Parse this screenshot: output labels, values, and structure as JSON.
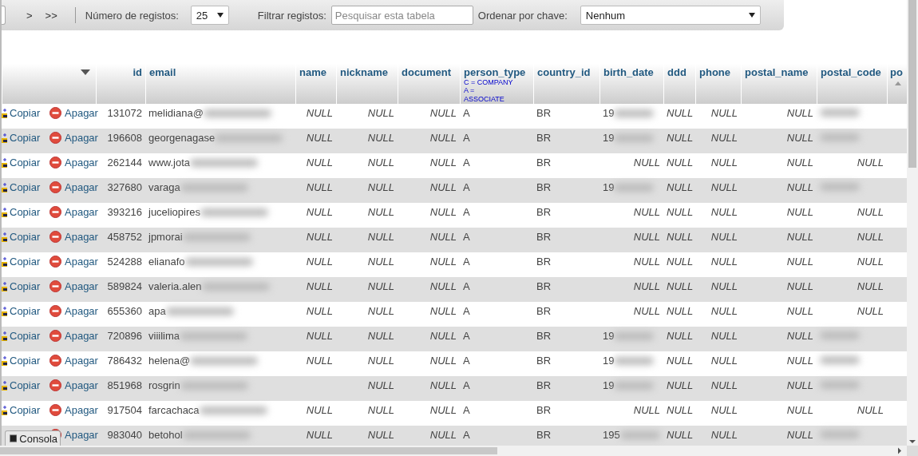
{
  "toolbar": {
    "nav_buttons": [
      ">",
      ">>"
    ],
    "rows_label": "Número de registos:",
    "rows_value": "25",
    "filter_label": "Filtrar registos:",
    "filter_placeholder": "Pesquisar esta tabela",
    "sort_label": "Ordenar por chave:",
    "sort_value": "Nenhum"
  },
  "table": {
    "columns": [
      {
        "label": "id"
      },
      {
        "label": "email"
      },
      {
        "label": "name"
      },
      {
        "label": "nickname"
      },
      {
        "label": "document"
      },
      {
        "label": "person_type",
        "comment": "C = COMPANY\nA =\nASSOCIATE"
      },
      {
        "label": "country_id"
      },
      {
        "label": "birth_date"
      },
      {
        "label": "ddd"
      },
      {
        "label": "phone"
      },
      {
        "label": "postal_name"
      },
      {
        "label": "postal_code"
      },
      {
        "label": "po"
      }
    ],
    "rows": [
      {
        "copy": "Copiar",
        "delete": "Apagar",
        "cells": [
          "131072",
          {
            "text": "melidiana@",
            "kind": "blurred"
          },
          {
            "text": "NULL",
            "kind": "null"
          },
          {
            "text": "NULL",
            "kind": "null"
          },
          {
            "text": "NULL",
            "kind": "null"
          },
          "A",
          "BR",
          {
            "text": "19",
            "kind": "blurred"
          },
          {
            "text": "NULL",
            "kind": "null"
          },
          {
            "text": "NULL",
            "kind": "null"
          },
          {
            "text": "NULL",
            "kind": "null"
          },
          {
            "kind": "blurred"
          }
        ]
      },
      {
        "copy": "Copiar",
        "delete": "Apagar",
        "cells": [
          "196608",
          {
            "text": "georgenagase",
            "kind": "blurred"
          },
          {
            "text": "NULL",
            "kind": "null"
          },
          {
            "text": "NULL",
            "kind": "null"
          },
          {
            "text": "NULL",
            "kind": "null"
          },
          "A",
          "BR",
          {
            "text": "19",
            "kind": "blurred"
          },
          {
            "text": "NULL",
            "kind": "null"
          },
          {
            "text": "NULL",
            "kind": "null"
          },
          {
            "text": "NULL",
            "kind": "null"
          },
          {
            "kind": "blurred"
          }
        ]
      },
      {
        "copy": "Copiar",
        "delete": "Apagar",
        "cells": [
          "262144",
          {
            "text": "www.jota",
            "kind": "blurred"
          },
          {
            "text": "NULL",
            "kind": "null"
          },
          {
            "text": "NULL",
            "kind": "null"
          },
          {
            "text": "NULL",
            "kind": "null"
          },
          "A",
          "BR",
          {
            "text": "NULL",
            "kind": "null"
          },
          {
            "text": "NULL",
            "kind": "null"
          },
          {
            "text": "NULL",
            "kind": "null"
          },
          {
            "text": "NULL",
            "kind": "null"
          },
          {
            "text": "NULL",
            "kind": "null"
          }
        ]
      },
      {
        "copy": "Copiar",
        "delete": "Apagar",
        "cells": [
          "327680",
          {
            "text": "varaga",
            "kind": "blurred"
          },
          {
            "text": "NULL",
            "kind": "null"
          },
          {
            "text": "NULL",
            "kind": "null"
          },
          {
            "text": "NULL",
            "kind": "null"
          },
          "A",
          "BR",
          {
            "text": "19",
            "kind": "blurred"
          },
          {
            "text": "NULL",
            "kind": "null"
          },
          {
            "text": "NULL",
            "kind": "null"
          },
          {
            "text": "NULL",
            "kind": "null"
          },
          {
            "kind": "blurred"
          }
        ]
      },
      {
        "copy": "Copiar",
        "delete": "Apagar",
        "cells": [
          "393216",
          {
            "text": "juceliopires",
            "kind": "blurred"
          },
          {
            "text": "NULL",
            "kind": "null"
          },
          {
            "text": "NULL",
            "kind": "null"
          },
          {
            "text": "NULL",
            "kind": "null"
          },
          "A",
          "BR",
          {
            "text": "NULL",
            "kind": "null"
          },
          {
            "text": "NULL",
            "kind": "null"
          },
          {
            "text": "NULL",
            "kind": "null"
          },
          {
            "text": "NULL",
            "kind": "null"
          },
          {
            "text": "NULL",
            "kind": "null"
          }
        ]
      },
      {
        "copy": "Copiar",
        "delete": "Apagar",
        "cells": [
          "458752",
          {
            "text": "jpmorai",
            "kind": "blurred"
          },
          {
            "text": "NULL",
            "kind": "null"
          },
          {
            "text": "NULL",
            "kind": "null"
          },
          {
            "text": "NULL",
            "kind": "null"
          },
          "A",
          "BR",
          {
            "text": "NULL",
            "kind": "null"
          },
          {
            "text": "NULL",
            "kind": "null"
          },
          {
            "text": "NULL",
            "kind": "null"
          },
          {
            "text": "NULL",
            "kind": "null"
          },
          {
            "text": "NULL",
            "kind": "null"
          }
        ]
      },
      {
        "copy": "Copiar",
        "delete": "Apagar",
        "cells": [
          "524288",
          {
            "text": "elianafo",
            "kind": "blurred"
          },
          {
            "text": "NULL",
            "kind": "null"
          },
          {
            "text": "NULL",
            "kind": "null"
          },
          {
            "text": "NULL",
            "kind": "null"
          },
          "A",
          "BR",
          {
            "text": "NULL",
            "kind": "null"
          },
          {
            "text": "NULL",
            "kind": "null"
          },
          {
            "text": "NULL",
            "kind": "null"
          },
          {
            "text": "NULL",
            "kind": "null"
          },
          {
            "text": "NULL",
            "kind": "null"
          }
        ]
      },
      {
        "copy": "Copiar",
        "delete": "Apagar",
        "cells": [
          "589824",
          {
            "text": "valeria.alen",
            "kind": "blurred"
          },
          {
            "text": "NULL",
            "kind": "null"
          },
          {
            "text": "NULL",
            "kind": "null"
          },
          {
            "text": "NULL",
            "kind": "null"
          },
          "A",
          "BR",
          {
            "text": "NULL",
            "kind": "null"
          },
          {
            "text": "NULL",
            "kind": "null"
          },
          {
            "text": "NULL",
            "kind": "null"
          },
          {
            "text": "NULL",
            "kind": "null"
          },
          {
            "text": "NULL",
            "kind": "null"
          }
        ]
      },
      {
        "copy": "Copiar",
        "delete": "Apagar",
        "cells": [
          "655360",
          {
            "text": "apa",
            "kind": "blurred"
          },
          {
            "text": "NULL",
            "kind": "null"
          },
          {
            "text": "NULL",
            "kind": "null"
          },
          {
            "text": "NULL",
            "kind": "null"
          },
          "A",
          "BR",
          {
            "text": "NULL",
            "kind": "null"
          },
          {
            "text": "NULL",
            "kind": "null"
          },
          {
            "text": "NULL",
            "kind": "null"
          },
          {
            "text": "NULL",
            "kind": "null"
          },
          {
            "text": "NULL",
            "kind": "null"
          }
        ]
      },
      {
        "copy": "Copiar",
        "delete": "Apagar",
        "cells": [
          "720896",
          {
            "text": "viiilima",
            "kind": "blurred"
          },
          {
            "text": "NULL",
            "kind": "null"
          },
          {
            "text": "NULL",
            "kind": "null"
          },
          {
            "text": "NULL",
            "kind": "null"
          },
          "A",
          "BR",
          {
            "text": "19",
            "kind": "blurred"
          },
          {
            "text": "NULL",
            "kind": "null"
          },
          {
            "text": "NULL",
            "kind": "null"
          },
          {
            "text": "NULL",
            "kind": "null"
          },
          {
            "kind": "blurred"
          }
        ]
      },
      {
        "copy": "Copiar",
        "delete": "Apagar",
        "cells": [
          "786432",
          {
            "text": "helena@",
            "kind": "blurred"
          },
          {
            "text": "NULL",
            "kind": "null"
          },
          {
            "text": "NULL",
            "kind": "null"
          },
          {
            "text": "NULL",
            "kind": "null"
          },
          "A",
          "BR",
          {
            "text": "19",
            "kind": "blurred"
          },
          {
            "text": "NULL",
            "kind": "null"
          },
          {
            "text": "NULL",
            "kind": "null"
          },
          {
            "text": "NULL",
            "kind": "null"
          },
          {
            "kind": "blurred"
          }
        ]
      },
      {
        "copy": "Copiar",
        "delete": "Apagar",
        "cells": [
          "851968",
          {
            "text": "rosgrin",
            "kind": "blurred"
          },
          null,
          {
            "text": "NULL",
            "kind": "null"
          },
          {
            "text": "NULL",
            "kind": "null"
          },
          "A",
          "BR",
          {
            "text": "19",
            "kind": "blurred"
          },
          {
            "text": "NULL",
            "kind": "null"
          },
          {
            "text": "NULL",
            "kind": "null"
          },
          {
            "text": "NULL",
            "kind": "null"
          },
          {
            "kind": "blurred"
          }
        ]
      },
      {
        "copy": "Copiar",
        "delete": "Apagar",
        "cells": [
          "917504",
          {
            "text": "farcachaca",
            "kind": "blurred"
          },
          {
            "text": "NULL",
            "kind": "null"
          },
          {
            "text": "NULL",
            "kind": "null"
          },
          {
            "text": "NULL",
            "kind": "null"
          },
          "A",
          "BR",
          {
            "text": "NULL",
            "kind": "null"
          },
          {
            "text": "NULL",
            "kind": "null"
          },
          {
            "text": "NULL",
            "kind": "null"
          },
          {
            "text": "NULL",
            "kind": "null"
          },
          {
            "text": "NULL",
            "kind": "null"
          }
        ]
      },
      {
        "delete": "Apagar",
        "cells": [
          "983040",
          {
            "text": "betohol",
            "kind": "blurred"
          },
          {
            "text": "NULL",
            "kind": "null"
          },
          {
            "text": "NULL",
            "kind": "null"
          },
          {
            "text": "NULL",
            "kind": "null"
          },
          "A",
          "BR",
          {
            "text": "195",
            "kind": "blurred"
          },
          {
            "text": "NULL",
            "kind": "null"
          },
          {
            "text": "NULL",
            "kind": "null"
          },
          {
            "text": "NULL",
            "kind": "null"
          },
          {
            "kind": "blurred"
          }
        ]
      }
    ]
  },
  "console": {
    "label": "Consola"
  }
}
